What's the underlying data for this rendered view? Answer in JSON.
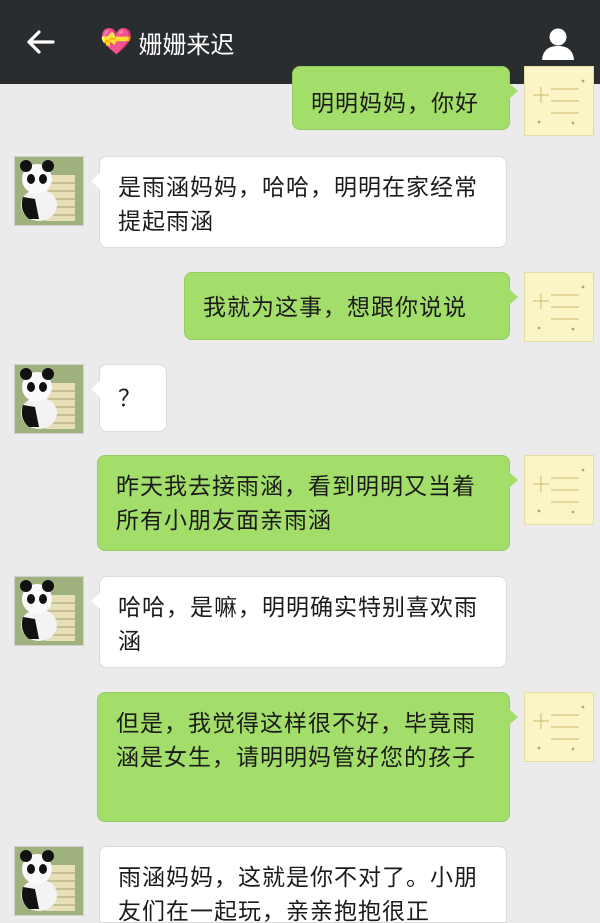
{
  "header": {
    "back_icon": "back-arrow-icon",
    "title_icon": "heart-gift-icon",
    "title": "姗姗来迟",
    "profile_icon": "profile-icon"
  },
  "messages": [
    {
      "side": "out",
      "text": "明明妈妈，你好"
    },
    {
      "side": "in",
      "text": "是雨涵妈妈，哈哈，明明在家经常提起雨涵"
    },
    {
      "side": "out",
      "text": "我就为这事，想跟你说说"
    },
    {
      "side": "in",
      "text": "？"
    },
    {
      "side": "out",
      "text": "昨天我去接雨涵，看到明明又当着所有小朋友面亲雨涵"
    },
    {
      "side": "in",
      "text": "哈哈，是嘛，明明确实特别喜欢雨涵"
    },
    {
      "side": "out",
      "text": "但是，我觉得这样很不好，毕竟雨涵是女生，请明明妈管好您的孩子"
    },
    {
      "side": "in",
      "text": "雨涵妈妈，这就是你不对了。小朋友们在一起玩，亲亲抱抱很正"
    }
  ],
  "colors": {
    "topbar": "#2a2d30",
    "background": "#ebebeb",
    "outgoing_bubble": "#a3dd6a",
    "incoming_bubble": "#ffffff"
  }
}
